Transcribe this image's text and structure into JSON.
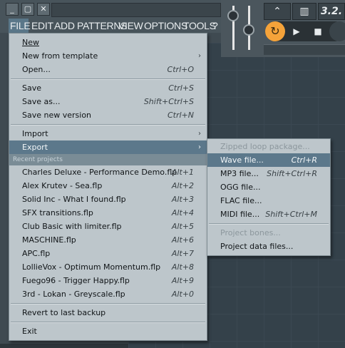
{
  "titlebar": {
    "minimize_glyph": "_",
    "restore_glyph": "▢",
    "close_glyph": "✕",
    "counter_display": "3.2."
  },
  "menubar": {
    "items": [
      "FILE",
      "EDIT",
      "ADD",
      "PATTERNS",
      "VIEW",
      "OPTIONS",
      "TOOLS",
      "?"
    ],
    "active": "FILE"
  },
  "transport": {
    "play_glyph": "▶",
    "stop_glyph": "■",
    "loop_glyph": "↻"
  },
  "file_menu": {
    "new": {
      "label": "New"
    },
    "new_template": {
      "label": "New from template",
      "arrow": "›"
    },
    "open": {
      "label": "Open...",
      "shortcut": "Ctrl+O"
    },
    "save": {
      "label": "Save",
      "shortcut": "Ctrl+S"
    },
    "save_as": {
      "label": "Save as...",
      "shortcut": "Shift+Ctrl+S"
    },
    "save_new_version": {
      "label": "Save new version",
      "shortcut": "Ctrl+N"
    },
    "import": {
      "label": "Import",
      "arrow": "›"
    },
    "export": {
      "label": "Export",
      "arrow": "›"
    },
    "recent_header": "Recent projects",
    "recent": [
      {
        "label": "Charles Deluxe - Performance Demo.flp",
        "shortcut": "Alt+1"
      },
      {
        "label": "Alex Krutev - Sea.flp",
        "shortcut": "Alt+2"
      },
      {
        "label": "Solid Inc - What I found.flp",
        "shortcut": "Alt+3"
      },
      {
        "label": "SFX transitions.flp",
        "shortcut": "Alt+4"
      },
      {
        "label": "Club Basic with limiter.flp",
        "shortcut": "Alt+5"
      },
      {
        "label": "MASCHINE.flp",
        "shortcut": "Alt+6"
      },
      {
        "label": "APC.flp",
        "shortcut": "Alt+7"
      },
      {
        "label": "LollieVox - Optimum Momentum.flp",
        "shortcut": "Alt+8"
      },
      {
        "label": "Fuego96 - Trigger Happy.flp",
        "shortcut": "Alt+9"
      },
      {
        "label": "3rd - Lokan - Greyscale.flp",
        "shortcut": "Alt+0"
      }
    ],
    "revert": {
      "label": "Revert to last backup"
    },
    "exit": {
      "label": "Exit"
    }
  },
  "export_menu": {
    "zipped": {
      "label": "Zipped loop package..."
    },
    "wave": {
      "label": "Wave file...",
      "shortcut": "Ctrl+R"
    },
    "mp3": {
      "label": "MP3 file...",
      "shortcut": "Shift+Ctrl+R"
    },
    "ogg": {
      "label": "OGG file..."
    },
    "flac": {
      "label": "FLAC file..."
    },
    "midi": {
      "label": "MIDI file...",
      "shortcut": "Shift+Ctrl+M"
    },
    "project_bones": {
      "label": "Project bones..."
    },
    "project_data": {
      "label": "Project data files..."
    }
  },
  "colors": {
    "menu_bg": "#bdc6cb",
    "highlight": "#5c788b",
    "accent_orange": "#f5a33a",
    "app_bg": "#3f4a51"
  }
}
